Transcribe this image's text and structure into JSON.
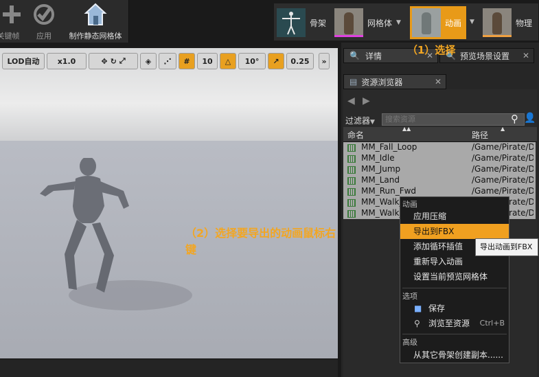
{
  "toolbar": {
    "key_label": "关键帧",
    "apply_label": "应用",
    "make_static_label": "制作静态网格体"
  },
  "modes": {
    "skeleton": "骨架",
    "mesh": "网格体",
    "animation": "动画",
    "physics": "物理"
  },
  "viewport": {
    "lod": "LOD自动",
    "speed": "x1.0",
    "grid_snap": "10",
    "angle_snap": "10°",
    "scale_snap": "0.25"
  },
  "tabs": {
    "details": "详情",
    "preview_scene": "预览场景设置",
    "asset_browser": "资源浏览器"
  },
  "asset_browser": {
    "filter_label": "过滤器",
    "search_placeholder": "搜索资源",
    "col_name": "命名",
    "col_path": "路径",
    "assets": [
      {
        "name": "MM_Fall_Loop",
        "path": "/Game/Pirate/De"
      },
      {
        "name": "MM_Idle",
        "path": "/Game/Pirate/De"
      },
      {
        "name": "MM_Jump",
        "path": "/Game/Pirate/De"
      },
      {
        "name": "MM_Land",
        "path": "/Game/Pirate/De"
      },
      {
        "name": "MM_Run_Fwd",
        "path": "/Game/Pirate/De"
      },
      {
        "name": "MM_Walk_",
        "path": "/Game/Pirate/De"
      },
      {
        "name": "MM_Walk_",
        "path": "/Game/Pirate/De"
      }
    ]
  },
  "context_menu": {
    "section_animation": "动画",
    "apply_compression": "应用压缩",
    "export_fbx": "导出到FBX",
    "add_loop_interp": "添加循环插值",
    "reimport": "重新导入动画",
    "set_preview_mesh": "设置当前预览网格体",
    "section_options": "选项",
    "save": "保存",
    "browse_to_asset": "浏览至资源",
    "browse_shortcut": "Ctrl+B",
    "section_advanced": "高级",
    "create_copy": "从其它骨架创建副本......"
  },
  "tooltip": "导出动画到FBX",
  "annotations": {
    "step1": "（1）选择",
    "step2": "（2）选择要导出的动画鼠标右键"
  },
  "colors": {
    "accent": "#f0a020",
    "annotation": "#f2a623"
  }
}
